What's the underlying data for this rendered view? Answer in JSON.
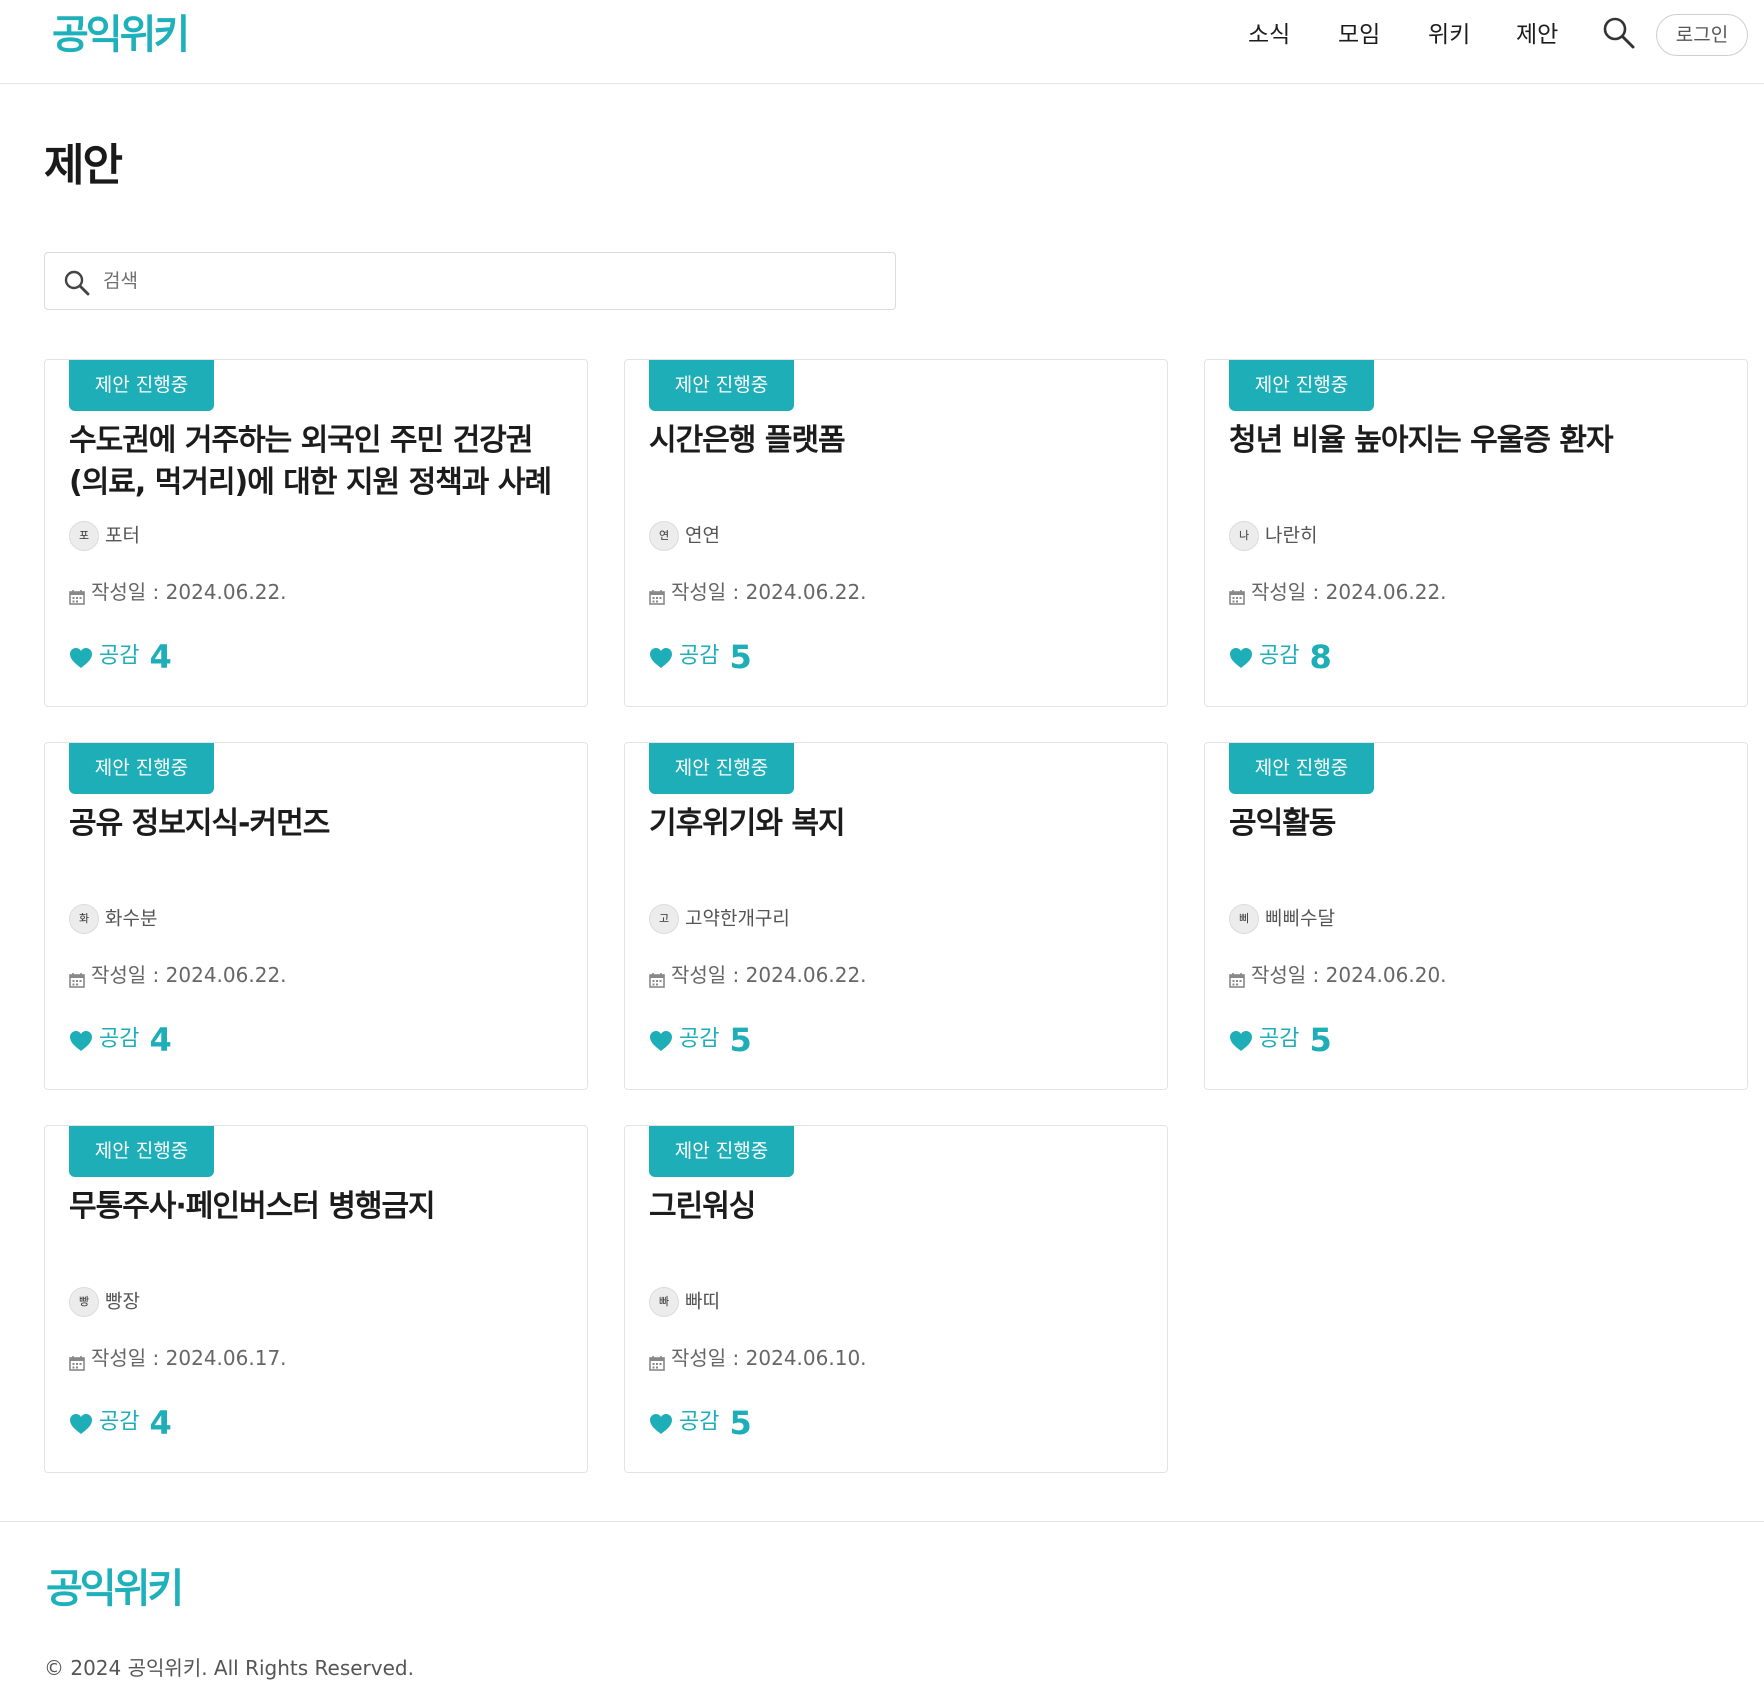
{
  "header": {
    "logo": "공익위키",
    "nav": [
      "소식",
      "모임",
      "위키",
      "제안"
    ],
    "login_label": "로그인"
  },
  "page": {
    "title": "제안",
    "search_placeholder": "검색"
  },
  "colors": {
    "accent": "#1eaeb8"
  },
  "labels": {
    "likes_label": "공감"
  },
  "cards": [
    {
      "badge": "제안 진행중",
      "title": "수도권에 거주하는 외국인 주민 건강권 (의료, 먹거리)에 대한 지원 정책과 사례",
      "avatar": "포",
      "author": "포터",
      "date": "작성일 : 2024.06.22.",
      "likes": "4"
    },
    {
      "badge": "제안 진행중",
      "title": "시간은행 플랫폼",
      "avatar": "연",
      "author": "연연",
      "date": "작성일 : 2024.06.22.",
      "likes": "5"
    },
    {
      "badge": "제안 진행중",
      "title": "청년 비율 높아지는 우울증 환자",
      "avatar": "나",
      "author": "나란히",
      "date": "작성일 : 2024.06.22.",
      "likes": "8"
    },
    {
      "badge": "제안 진행중",
      "title": "공유 정보지식-커먼즈",
      "avatar": "화",
      "author": "화수분",
      "date": "작성일 : 2024.06.22.",
      "likes": "4"
    },
    {
      "badge": "제안 진행중",
      "title": "기후위기와 복지",
      "avatar": "고",
      "author": "고약한개구리",
      "date": "작성일 : 2024.06.22.",
      "likes": "5"
    },
    {
      "badge": "제안 진행중",
      "title": "공익활동",
      "avatar": "삐",
      "author": "삐삐수달",
      "date": "작성일 : 2024.06.20.",
      "likes": "5"
    },
    {
      "badge": "제안 진행중",
      "title": "무통주사·페인버스터 병행금지",
      "avatar": "빵",
      "author": "빵장",
      "date": "작성일 : 2024.06.17.",
      "likes": "4"
    },
    {
      "badge": "제안 진행중",
      "title": "그린워싱",
      "avatar": "빠",
      "author": "빠띠",
      "date": "작성일 : 2024.06.10.",
      "likes": "5"
    }
  ],
  "footer": {
    "logo": "공익위키",
    "copyright": "© 2024 공익위키. All Rights Reserved."
  }
}
